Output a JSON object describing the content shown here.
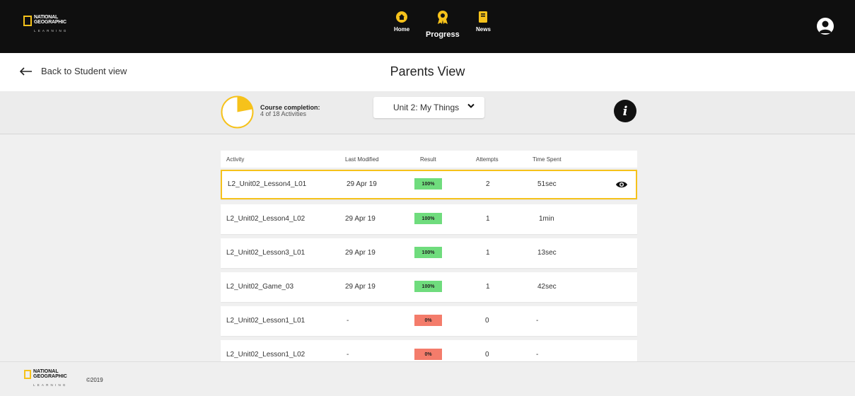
{
  "brand": {
    "logo_line1": "NATIONAL",
    "logo_line2": "GEOGRAPHIC",
    "logo_line3": "LEARNING",
    "accent_color": "#f6c21b"
  },
  "nav": {
    "items": [
      {
        "label": "Home",
        "icon": "home-icon"
      },
      {
        "label": "Progress",
        "icon": "award-icon"
      },
      {
        "label": "News",
        "icon": "book-icon"
      }
    ],
    "active": "Progress"
  },
  "header": {
    "back_label": "Back to Student view",
    "title": "Parents View"
  },
  "summary": {
    "completion_title": "Course completion:",
    "completion_detail": "4 of 18 Activities",
    "completion_fraction": 0.22,
    "unit_selected": "Unit 2: My Things"
  },
  "table": {
    "columns": [
      "Activity",
      "Last Modified",
      "Result",
      "Attempts",
      "Time Spent"
    ],
    "rows": [
      {
        "activity": "L2_Unit02_Lesson4_L01",
        "modified": "29 Apr 19",
        "result": "100%",
        "attempts": "2",
        "time": "51sec",
        "pass": true
      },
      {
        "activity": "L2_Unit02_Lesson4_L02",
        "modified": "29 Apr 19",
        "result": "100%",
        "attempts": "1",
        "time": "1min",
        "pass": true
      },
      {
        "activity": "L2_Unit02_Lesson3_L01",
        "modified": "29 Apr 19",
        "result": "100%",
        "attempts": "1",
        "time": "13sec",
        "pass": true
      },
      {
        "activity": "L2_Unit02_Game_03",
        "modified": "29 Apr 19",
        "result": "100%",
        "attempts": "1",
        "time": "42sec",
        "pass": true
      },
      {
        "activity": "L2_Unit02_Lesson1_L01",
        "modified": "-",
        "result": "0%",
        "attempts": "0",
        "time": "-",
        "pass": false
      },
      {
        "activity": "L2_Unit02_Lesson1_L02",
        "modified": "-",
        "result": "0%",
        "attempts": "0",
        "time": "-",
        "pass": false
      }
    ],
    "pass_color": "#6fdc7d",
    "fail_color": "#f47c6b"
  },
  "footer": {
    "copyright": "©2019"
  }
}
